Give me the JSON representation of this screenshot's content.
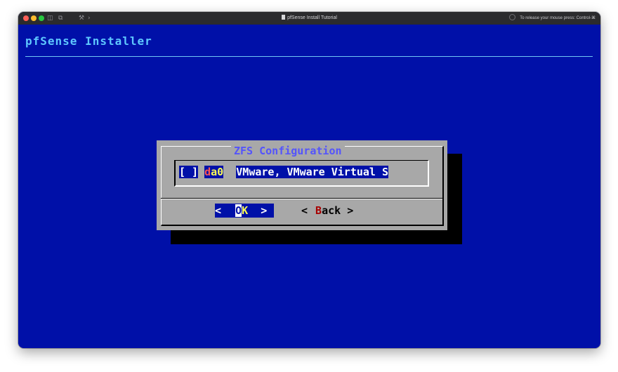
{
  "window": {
    "title": "pfSense Install Tutorial",
    "release_hint": "To release your mouse press: Control-⌘"
  },
  "installer": {
    "title": "pfSense Installer"
  },
  "dialog": {
    "title": "ZFS Configuration",
    "item": {
      "checkbox": "[ ]",
      "tag_first": "d",
      "tag_rest": "a0",
      "description": "VMware, VMware Virtual S"
    },
    "buttons": {
      "ok_left": "<",
      "ok_first": "O",
      "ok_rest": "K",
      "ok_right": ">",
      "back_left": "<",
      "back_first": "B",
      "back_rest": "ack",
      "back_right": ">"
    }
  },
  "colors": {
    "console_bg": "#0010a8",
    "dialog_bg": "#a8a8a8",
    "title_text": "#5454fc",
    "installer_title": "#5ec8ff",
    "hotkey_yellow": "#ffff54",
    "hotkey_red": "#a80000"
  },
  "icons": [
    "sidebar-icon",
    "snapshot-icon",
    "wrench-icon",
    "chevron-right-icon",
    "document-icon"
  ]
}
